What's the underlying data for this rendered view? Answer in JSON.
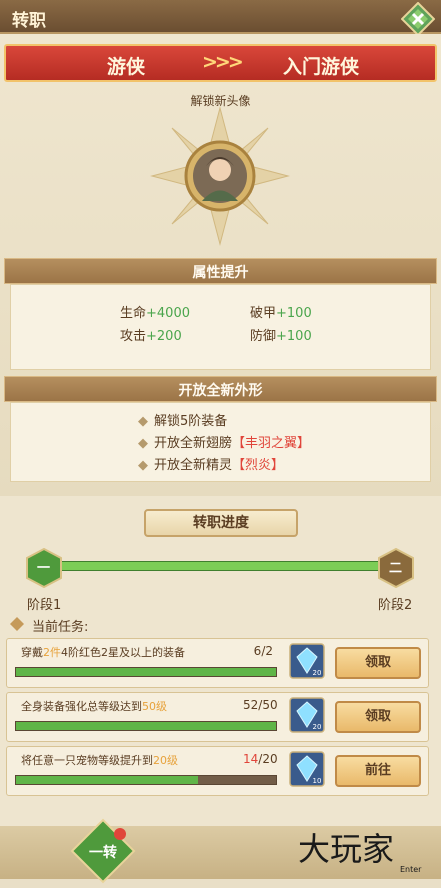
{
  "header": {
    "title": "转职"
  },
  "banner": {
    "from": "游侠",
    "arrows": ">>>",
    "to": "入门游侠"
  },
  "unlock": {
    "label": "解锁新头像"
  },
  "attributes": {
    "title": "属性提升",
    "items": [
      {
        "name": "生命",
        "value": "+4000"
      },
      {
        "name": "破甲",
        "value": "+100"
      },
      {
        "name": "攻击",
        "value": "+200"
      },
      {
        "name": "防御",
        "value": "+100"
      }
    ]
  },
  "features": {
    "title": "开放全新外形",
    "items": [
      {
        "text": "解锁5阶装备",
        "highlight": ""
      },
      {
        "text": "开放全新翅膀",
        "highlight": "【丰羽之翼】"
      },
      {
        "text": "开放全新精灵",
        "highlight": "【烈炎】"
      }
    ]
  },
  "progress": {
    "title": "转职进度",
    "stage1_glyph": "一",
    "stage2_glyph": "二",
    "stage1_label": "阶段1",
    "stage2_label": "阶段2",
    "fraction": 1.0
  },
  "tasks": {
    "title": "当前任务:",
    "items": [
      {
        "pre": "穿戴",
        "hl1": "2件",
        "mid": "4阶红色2星及以上的装备",
        "hl2": "",
        "post": "",
        "current": "6",
        "total": "2",
        "fraction": 1.0,
        "reward_count": "20",
        "button": "领取",
        "current_red": false
      },
      {
        "pre": "全身装备强化总等级达到",
        "hl1": "50级",
        "mid": "",
        "hl2": "",
        "post": "",
        "current": "52",
        "total": "50",
        "fraction": 1.0,
        "reward_count": "20",
        "button": "领取",
        "current_red": false
      },
      {
        "pre": "将任意一只宠物等级提升到",
        "hl1": "20级",
        "mid": "",
        "hl2": "",
        "post": "",
        "current": "14",
        "total": "20",
        "fraction": 0.7,
        "reward_count": "10",
        "button": "前往",
        "current_red": true
      }
    ]
  },
  "footer": {
    "tab_label": "一转"
  },
  "watermark": {
    "text": "大玩家",
    "sub": "Enter"
  },
  "colors": {
    "banner_red": "#c8382c",
    "progress_green": "#5fb548",
    "highlight_orange": "#e7a23b",
    "red_text": "#e0453a"
  }
}
